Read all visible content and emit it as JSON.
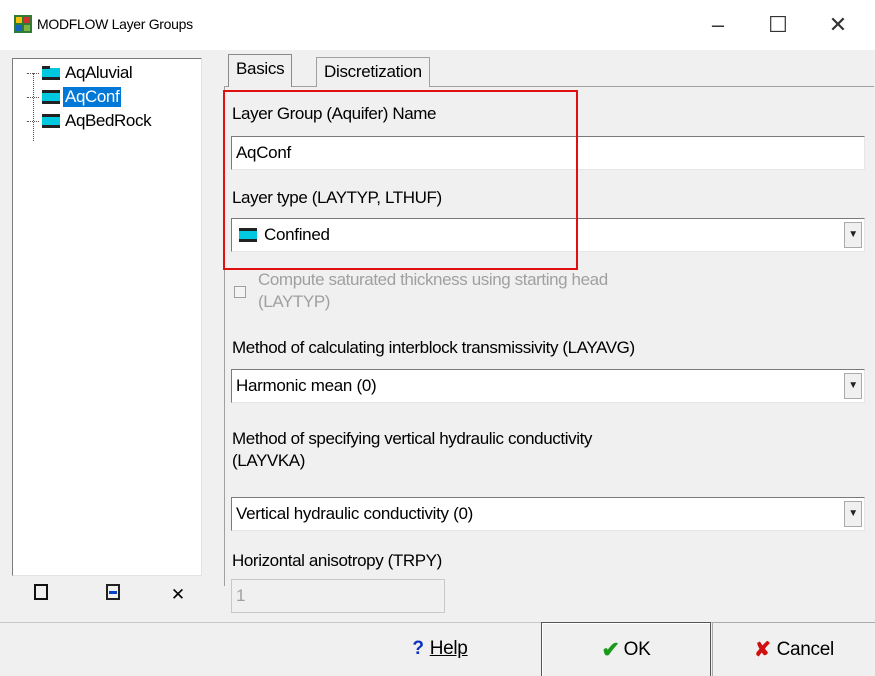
{
  "window": {
    "title": "MODFLOW Layer Groups",
    "minimize_glyph": "–",
    "maximize_glyph": "☐",
    "close_glyph": "✕"
  },
  "tree": {
    "items": [
      {
        "label": "AqAluvial",
        "selected": false
      },
      {
        "label": "AqConf",
        "selected": true
      },
      {
        "label": "AqBedRock",
        "selected": false
      }
    ],
    "toolbar": {
      "remove_glyph": "✕"
    }
  },
  "tabs": {
    "basics": "Basics",
    "discretization": "Discretization"
  },
  "form": {
    "name_label": "Layer Group (Aquifer) Name",
    "name_value": "AqConf",
    "layer_type_label": "Layer type (LAYTYP, LTHUF)",
    "layer_type_value": "Confined",
    "saturated_line1": "Compute saturated thickness using starting head",
    "saturated_line2": "(LAYTYP)",
    "layavg_label": "Method of calculating interblock transmissivity (LAYAVG)",
    "layavg_value": "Harmonic mean (0)",
    "layvka_label_1": "Method of specifying vertical hydraulic conductivity",
    "layvka_label_2": "(LAYVKA)",
    "layvka_value": "Vertical hydraulic conductivity (0)",
    "trpy_label": "Horizontal anisotropy (TRPY)",
    "trpy_value": "1",
    "combo_arrow": "▼"
  },
  "buttons": {
    "help_mark": "?",
    "help": "Help",
    "ok_mark": "✔",
    "ok": "OK",
    "cancel_mark": "✘",
    "cancel": "Cancel"
  },
  "colors": {
    "selection": "#0078d7",
    "layer_fill": "#00c8e0",
    "highlight_box": "#e01010"
  }
}
